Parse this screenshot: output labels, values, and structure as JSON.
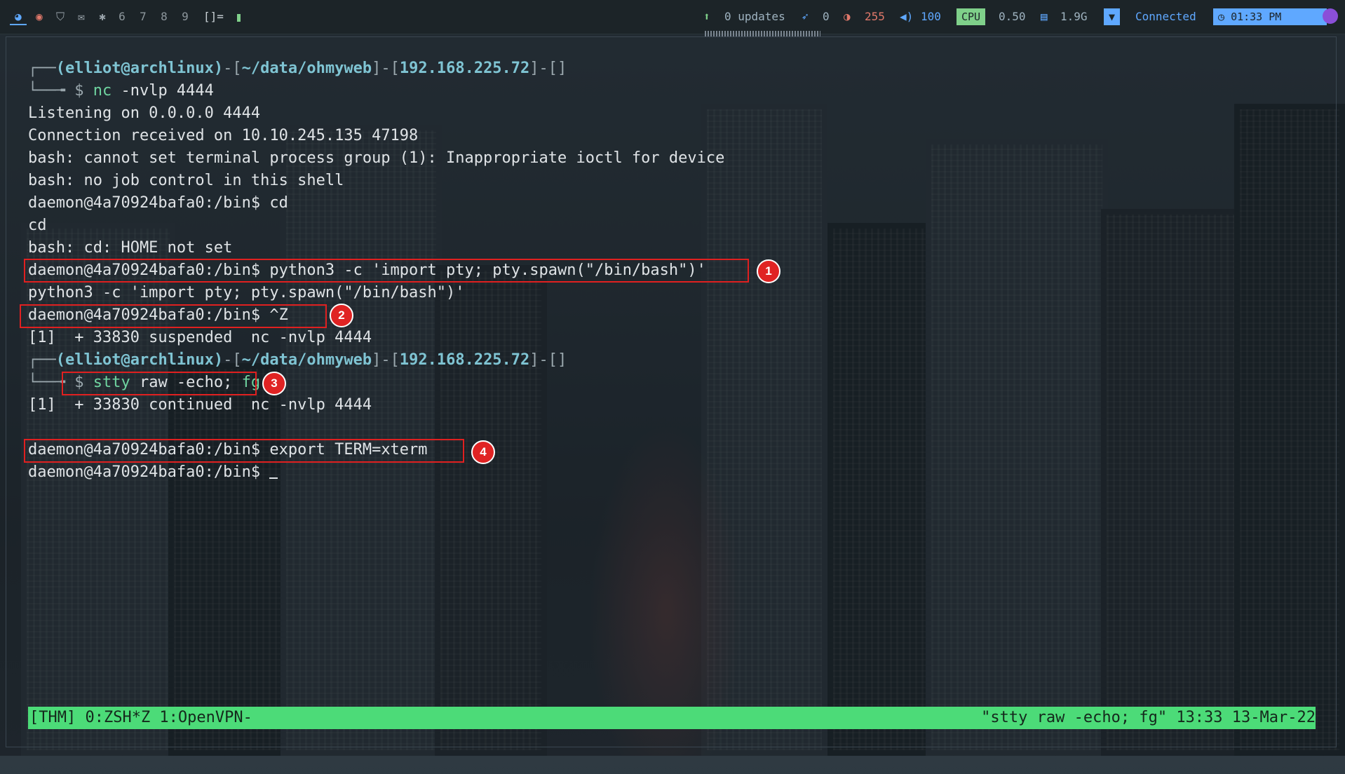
{
  "topbar": {
    "workspaces": [
      "6",
      "7",
      "8",
      "9"
    ],
    "layout_symbol": "[]=",
    "updates": "0 updates",
    "plugin_count": "0",
    "brightness": "255",
    "volume": "100",
    "cpu_label": "CPU",
    "cpu_value": "0.50",
    "memory": "1.9G",
    "network": "Connected",
    "clock": "01:33 PM",
    "accent": "#5fa8ff"
  },
  "terminal": {
    "prompt_user": "(elliot@archlinux)",
    "prompt_path": "~/data/ohmyweb",
    "prompt_ip": "192.168.225.72",
    "prompt_bracket": "[]",
    "cmd1_name": "nc",
    "cmd1_args": " -nvlp 4444",
    "lines": [
      "Listening on 0.0.0.0 4444",
      "Connection received on 10.10.245.135 47198",
      "bash: cannot set terminal process group (1): Inappropriate ioctl for device",
      "bash: no job control in this shell",
      "daemon@4a70924bafa0:/bin$ cd",
      "cd",
      "bash: cd: HOME not set",
      "daemon@4a70924bafa0:/bin$ python3 -c 'import pty; pty.spawn(\"/bin/bash\")'",
      "python3 -c 'import pty; pty.spawn(\"/bin/bash\")'",
      "daemon@4a70924bafa0:/bin$ ^Z",
      "[1]  + 33830 suspended  nc -nvlp 4444"
    ],
    "cmd2_stty": "stty",
    "cmd2_mid": " raw -echo; ",
    "cmd2_fg": "fg",
    "continued": "[1]  + 33830 continued  nc -nvlp 4444",
    "export_line": "daemon@4a70924bafa0:/bin$ export TERM=xterm",
    "last_prompt": "daemon@4a70924bafa0:/bin$ ",
    "badges": [
      "1",
      "2",
      "3",
      "4"
    ],
    "highlight_color": "#e02020"
  },
  "tmux": {
    "left": "[THM] 0:ZSH*Z 1:OpenVPN-",
    "right": "\"stty raw -echo; fg\" 13:33 13-Mar-22",
    "color": "#4cdb78"
  }
}
